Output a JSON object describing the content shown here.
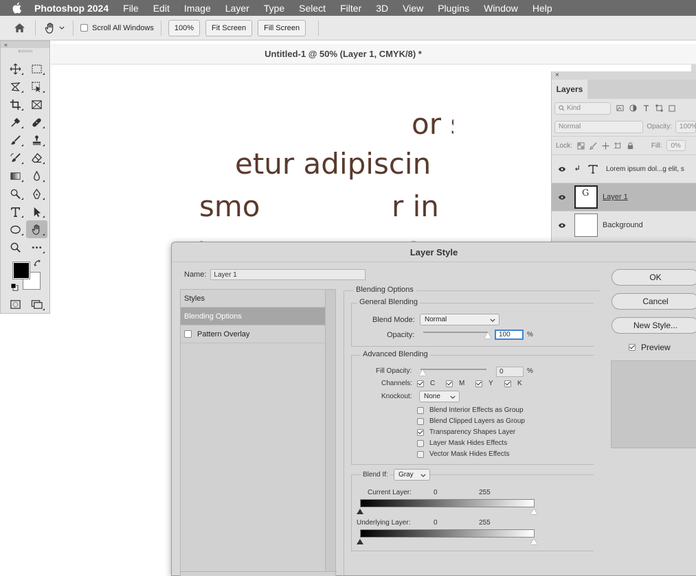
{
  "menubar": {
    "app": "Photoshop 2024",
    "items": [
      "File",
      "Edit",
      "Image",
      "Layer",
      "Type",
      "Select",
      "Filter",
      "3D",
      "View",
      "Plugins",
      "Window",
      "Help"
    ]
  },
  "options_bar": {
    "scroll_all_windows": "Scroll All Windows",
    "zoom_100": "100%",
    "fit_screen": "Fit Screen",
    "fill_screen": "Fill Screen"
  },
  "document": {
    "tab_title": "Untitled-1 @ 50% (Layer 1, CMYK/8) *",
    "canvas_lines": [
      "or s",
      "etur adipiscin",
      "smo",
      "r in",
      "n",
      "a"
    ]
  },
  "tools": {
    "collapse": "«"
  },
  "layers_panel": {
    "close": "×",
    "tab": "Layers",
    "kind": "Kind",
    "mode": "Normal",
    "opacity_label": "Opacity:",
    "opacity_value": "100%",
    "lock_label": "Lock:",
    "fill_label": "Fill:",
    "fill_value": "0%",
    "layers": [
      {
        "name": "Lorem ipsum dol...g elit, s",
        "kind": "type"
      },
      {
        "name": "Layer 1",
        "kind": "pixel",
        "thumb_glyph": "G"
      },
      {
        "name": "Background",
        "kind": "background"
      }
    ]
  },
  "dialog": {
    "title": "Layer Style",
    "name_label": "Name:",
    "name_value": "Layer 1",
    "styles": {
      "header": "Styles",
      "blending_options": "Blending Options",
      "pattern_overlay": "Pattern Overlay"
    },
    "blending_options": {
      "section": "Blending Options",
      "general": "General Blending",
      "blend_mode_label": "Blend Mode:",
      "blend_mode_value": "Normal",
      "opacity_label": "Opacity:",
      "opacity_value": "100",
      "percent": "%"
    },
    "advanced": {
      "title": "Advanced Blending",
      "fill_opacity_label": "Fill Opacity:",
      "fill_opacity_value": "0",
      "percent": "%",
      "channels_label": "Channels:",
      "channels": [
        "C",
        "M",
        "Y",
        "K"
      ],
      "knockout_label": "Knockout:",
      "knockout_value": "None",
      "options": [
        {
          "label": "Blend Interior Effects as Group",
          "checked": false
        },
        {
          "label": "Blend Clipped Layers as Group",
          "checked": false
        },
        {
          "label": "Transparency Shapes Layer",
          "checked": true
        },
        {
          "label": "Layer Mask Hides Effects",
          "checked": false
        },
        {
          "label": "Vector Mask Hides Effects",
          "checked": false
        }
      ]
    },
    "blend_if": {
      "label": "Blend If:",
      "value": "Gray",
      "current_label": "Current Layer:",
      "underlying_label": "Underlying Layer:",
      "current_min": "0",
      "current_max": "255",
      "underlying_min": "0",
      "underlying_max": "255"
    },
    "buttons": {
      "ok": "OK",
      "cancel": "Cancel",
      "new_style": "New Style...",
      "preview": "Preview"
    }
  }
}
